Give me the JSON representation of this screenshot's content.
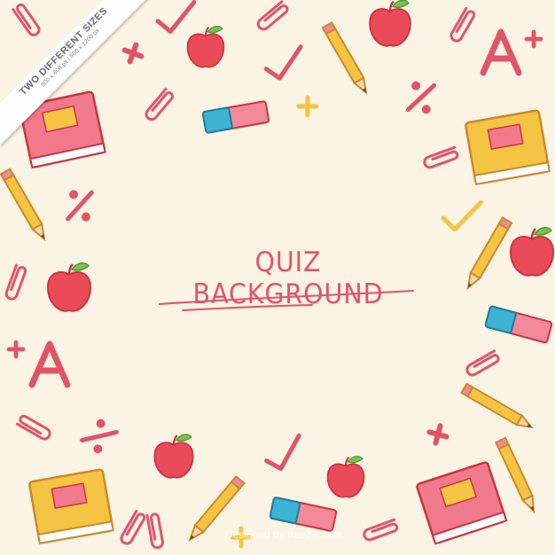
{
  "title": "QUIZ BACKGROUND",
  "ribbon": {
    "line1": "TWO DIFFERENT SIZES",
    "line2": "800 x 800 px / 800 x 1200 px"
  },
  "credit": "Designed by freepik.com",
  "colors": {
    "background": "#fbf3e4",
    "pink": "#e0546b",
    "red": "#ea4b58",
    "yellow": "#f5c443",
    "book_pink": "#f07a8c",
    "book_yellow": "#f5c443",
    "eraser_blue": "#3eb4d4",
    "eraser_pink": "#f2899a"
  },
  "icons": [
    "apple-icon",
    "book-icon",
    "pencil-icon",
    "paperclip-icon",
    "eraser-icon",
    "checkmark-icon",
    "plus-icon",
    "percent-icon",
    "letter-a-plus-icon"
  ]
}
